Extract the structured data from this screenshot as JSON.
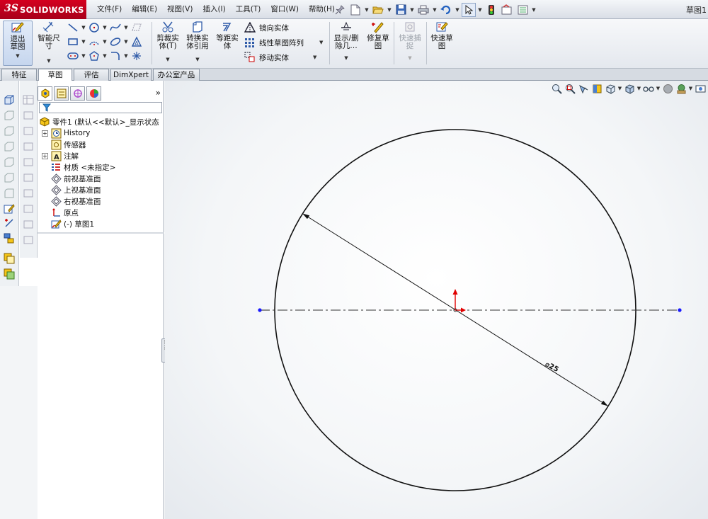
{
  "app": {
    "logo_ds": "3S",
    "logo_name": "SOLIDWORKS"
  },
  "menu": [
    "文件(F)",
    "编辑(E)",
    "视图(V)",
    "插入(I)",
    "工具(T)",
    "窗口(W)",
    "帮助(H)"
  ],
  "document_title": "草图1",
  "commands": {
    "exit_sketch": "退出草图",
    "smart_dimension": "智能尺寸",
    "trim": "剪裁实体(T)",
    "convert": "转换实体引用",
    "offset": "等距实体",
    "mirror": "镜向实体",
    "linear_pattern": "线性草图阵列",
    "move": "移动实体",
    "display_delete": "显示/删除几…",
    "repair": "修复草图",
    "quick_snap": "快速捕捉",
    "rapid_sketch": "快速草图"
  },
  "tabs": [
    "特征",
    "草图",
    "评估",
    "DimXpert",
    "办公室产品"
  ],
  "active_tab": "草图",
  "feature_tree": {
    "root": "零件1  (默认<<默认>_显示状态",
    "items": [
      {
        "label": "History",
        "expandable": true
      },
      {
        "label": "传感器",
        "expandable": false
      },
      {
        "label": "注解",
        "expandable": true
      },
      {
        "label": "材质 <未指定>",
        "expandable": false
      },
      {
        "label": "前视基准面",
        "expandable": false
      },
      {
        "label": "上视基准面",
        "expandable": false
      },
      {
        "label": "右视基准面",
        "expandable": false
      },
      {
        "label": "原点",
        "expandable": false
      },
      {
        "label": "(-) 草图1",
        "expandable": false
      }
    ]
  },
  "fm_expand": "»",
  "sketch": {
    "dimension_text": "⌀25",
    "circle_color": "#111111",
    "centerline_color": "#333333",
    "endpoint_color": "#1a1aff",
    "origin_color": "#e00000"
  },
  "icons": {
    "quickbar": [
      "new-icon",
      "open-icon",
      "save-icon",
      "print-icon",
      "undo-icon",
      "select-icon",
      "rebuild-icon",
      "file-properties-icon",
      "options-icon"
    ],
    "headsup": [
      "zoom-to-fit-icon",
      "zoom-area-icon",
      "previous-view-icon",
      "section-view-icon",
      "view-orientation-icon",
      "display-style-icon",
      "hide-show-icon",
      "appearance-icon",
      "scene-icon",
      "view-settings-icon"
    ]
  }
}
